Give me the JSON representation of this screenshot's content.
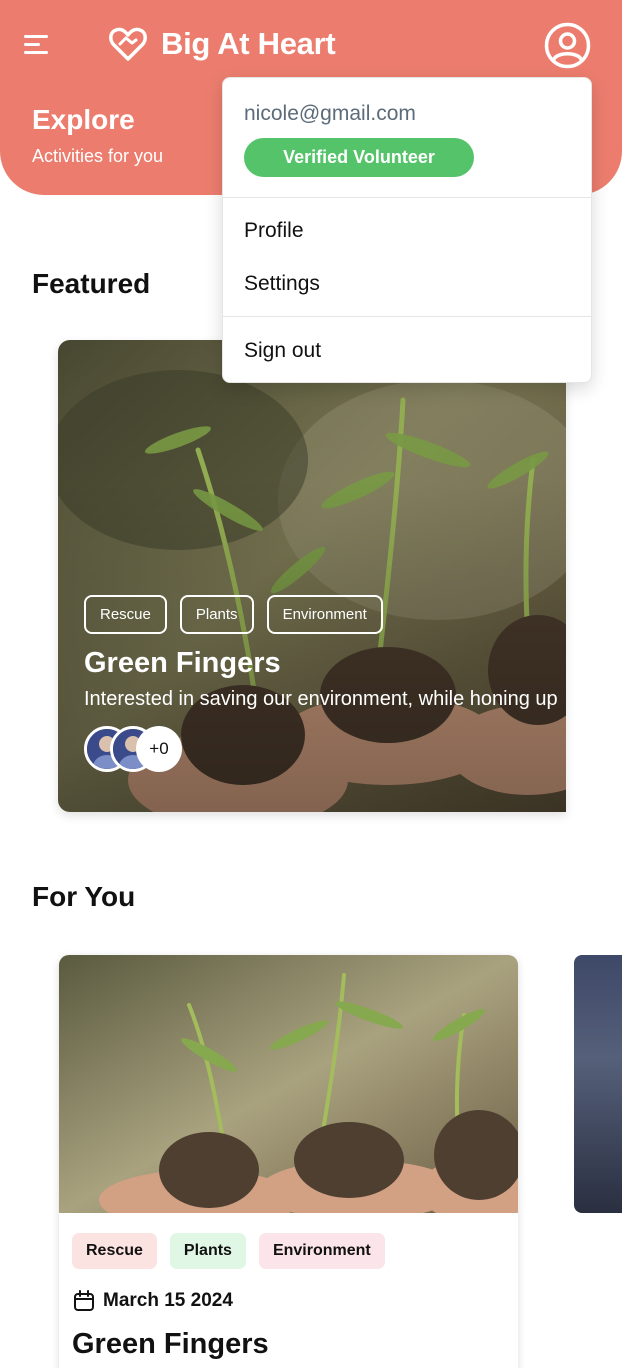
{
  "header": {
    "app_title": "Big At Heart",
    "explore_title": "Explore",
    "explore_subtitle": "Activities for you",
    "background_color": "#ec7d6e",
    "icons": [
      "menu-icon",
      "heart-hands-logo-icon",
      "user-circle-icon"
    ]
  },
  "featured": {
    "section_title": "Featured",
    "card": {
      "tags": [
        "Rescue",
        "Plants",
        "Environment"
      ],
      "title": "Green Fingers",
      "description": "Interested in saving our environment, while honing up",
      "participants_more": "+0"
    }
  },
  "for_you": {
    "section_title": "For You",
    "card": {
      "tags": [
        {
          "label": "Rescue",
          "bg": "#fbe3e1"
        },
        {
          "label": "Plants",
          "bg": "#dff7e4"
        },
        {
          "label": "Environment",
          "bg": "#fbe4ea"
        }
      ],
      "date": "March 15 2024",
      "title": "Green Fingers"
    }
  },
  "dropdown": {
    "email": "nicole@gmail.com",
    "badge": "Verified Volunteer",
    "badge_color": "#55c36a",
    "items": [
      "Profile",
      "Settings",
      "Sign out"
    ]
  }
}
